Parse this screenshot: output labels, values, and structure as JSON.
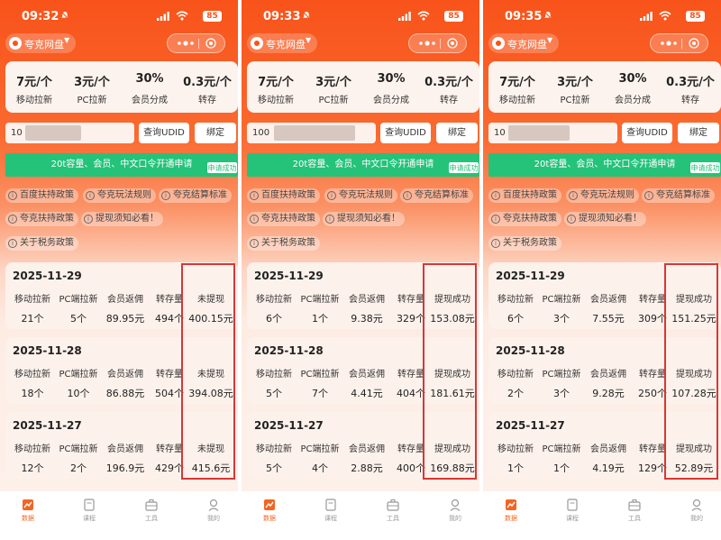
{
  "app_name": "夸克网盘",
  "rates": [
    {
      "value": "7元/个",
      "label": "移动拉新"
    },
    {
      "value": "3元/个",
      "label": "PC拉新"
    },
    {
      "value": "30%",
      "label": "会员分成"
    },
    {
      "value": "0.3元/个",
      "label": "转存"
    }
  ],
  "query_udid_label": "查询UDID",
  "bind_label": "绑定",
  "banner_text": "20t容量、会员、中文口令开通申请",
  "banner_badge": "申请成功",
  "policies": [
    "百度扶持政策",
    "夸克玩法规则",
    "夸克结算标准",
    "夸克扶持政策",
    "提现须知必看！",
    "关于税务政策"
  ],
  "metric_labels": [
    "移动拉新",
    "PC端拉新",
    "会员返佣",
    "转存量"
  ],
  "tabs": [
    "数据",
    "课程",
    "工具",
    "我的"
  ],
  "colors": {
    "accent": "#f8531a",
    "banner": "#25c27a",
    "highlight": "#d93636"
  },
  "phones": [
    {
      "time": "09:32",
      "battery": "85",
      "udid": "10",
      "days": [
        {
          "date": "2025-11-29",
          "values": [
            "21个",
            "5个",
            "89.95元",
            "494个"
          ],
          "status": "未提现",
          "amount": "400.15元"
        },
        {
          "date": "2025-11-28",
          "values": [
            "18个",
            "10个",
            "86.88元",
            "504个"
          ],
          "status": "未提现",
          "amount": "394.08元"
        },
        {
          "date": "2025-11-27",
          "values": [
            "12个",
            "2个",
            "196.9元",
            "429个"
          ],
          "status": "未提现",
          "amount": "415.6元"
        }
      ]
    },
    {
      "time": "09:33",
      "battery": "85",
      "udid": "100",
      "days": [
        {
          "date": "2025-11-29",
          "values": [
            "6个",
            "1个",
            "9.38元",
            "329个"
          ],
          "status": "提现成功",
          "amount": "153.08元"
        },
        {
          "date": "2025-11-28",
          "values": [
            "5个",
            "7个",
            "4.41元",
            "404个"
          ],
          "status": "提现成功",
          "amount": "181.61元"
        },
        {
          "date": "2025-11-27",
          "values": [
            "5个",
            "4个",
            "2.88元",
            "400个"
          ],
          "status": "提现成功",
          "amount": "169.88元"
        }
      ]
    },
    {
      "time": "09:35",
      "battery": "85",
      "udid": "10",
      "days": [
        {
          "date": "2025-11-29",
          "values": [
            "6个",
            "3个",
            "7.55元",
            "309个"
          ],
          "status": "提现成功",
          "amount": "151.25元"
        },
        {
          "date": "2025-11-28",
          "values": [
            "2个",
            "3个",
            "9.28元",
            "250个"
          ],
          "status": "提现成功",
          "amount": "107.28元"
        },
        {
          "date": "2025-11-27",
          "values": [
            "1个",
            "1个",
            "4.19元",
            "129个"
          ],
          "status": "提现成功",
          "amount": "52.89元"
        }
      ]
    }
  ]
}
